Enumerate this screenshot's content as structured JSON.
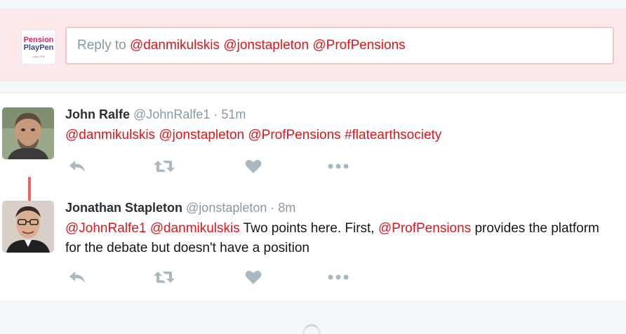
{
  "reply": {
    "avatar_line1": "Pension",
    "avatar_line2": "PlayPen",
    "avatar_sub": "Logo DPE",
    "prefix": "Reply to",
    "mentions": [
      "@danmikulskis",
      "@jonstapleton",
      "@ProfPensions"
    ]
  },
  "tweets": [
    {
      "fullname": "John Ralfe",
      "username": "@JohnRalfe1",
      "separator": "·",
      "time": "51m",
      "text_segments": [
        {
          "text": "@danmikulskis",
          "type": "mention"
        },
        {
          "text": " ",
          "type": "plain"
        },
        {
          "text": "@jonstapleton",
          "type": "mention"
        },
        {
          "text": " ",
          "type": "plain"
        },
        {
          "text": "@ProfPensions",
          "type": "mention"
        },
        {
          "text": " ",
          "type": "plain"
        },
        {
          "text": "#flatearthsociety",
          "type": "mention"
        }
      ]
    },
    {
      "fullname": "Jonathan Stapleton",
      "username": "@jonstapleton",
      "separator": "·",
      "time": "8m",
      "text_segments": [
        {
          "text": "@JohnRalfe1",
          "type": "mention"
        },
        {
          "text": " ",
          "type": "plain"
        },
        {
          "text": "@danmikulskis",
          "type": "mention"
        },
        {
          "text": " Two points here. First, ",
          "type": "plain"
        },
        {
          "text": "@ProfPensions",
          "type": "mention"
        },
        {
          "text": " provides the platform for the debate but doesn't have a position",
          "type": "plain"
        }
      ]
    }
  ],
  "icons": {
    "reply": "reply-icon",
    "retweet": "retweet-icon",
    "like": "heart-icon",
    "more": "more-icon"
  },
  "colors": {
    "mention": "#e0151b",
    "action_icon": "#aab8c2",
    "conversation_line": "#f2605f",
    "reply_bar_bg": "#fde8ea"
  }
}
